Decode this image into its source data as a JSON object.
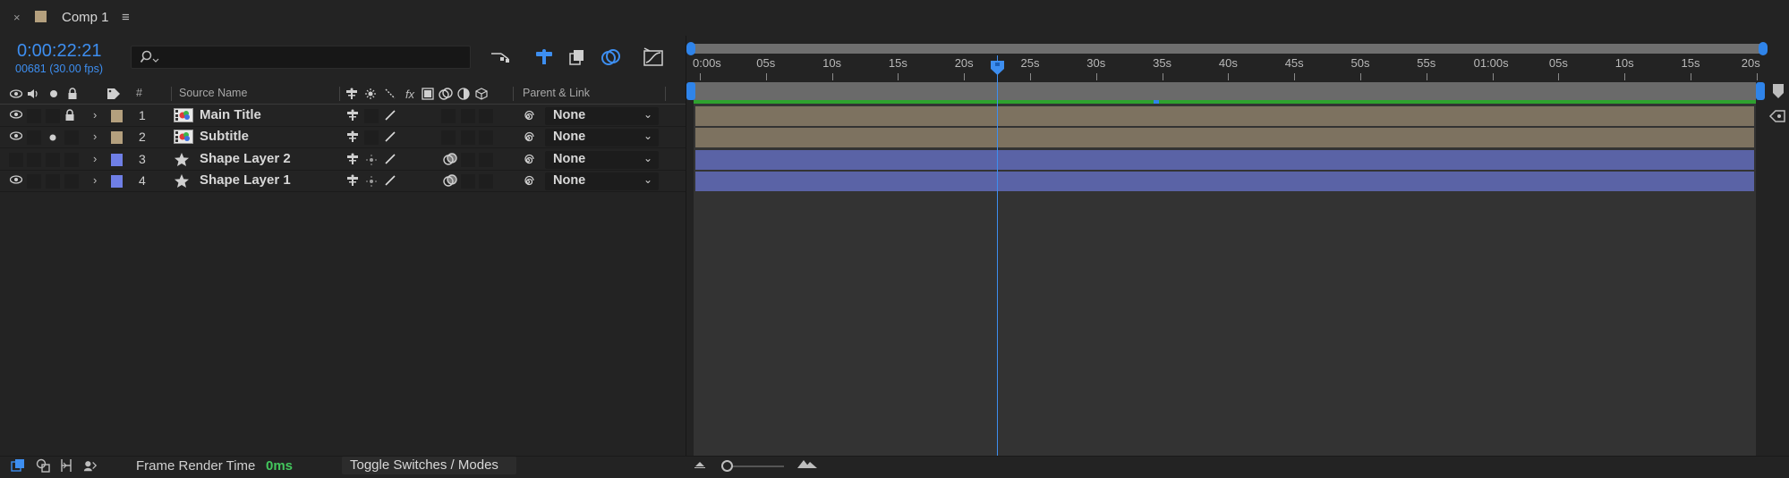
{
  "tab": {
    "close": "×",
    "title": "Comp 1",
    "menu": "≡",
    "swatch_color": "#b4a07e"
  },
  "header": {
    "timecode": "0:00:22:21",
    "frame_info": "00681 (30.00 fps)",
    "search_placeholder": "",
    "search_icon": "search-icon"
  },
  "columns": {
    "hash": "#",
    "source_name": "Source Name",
    "parent_link": "Parent & Link",
    "fx": "fx"
  },
  "layers": [
    {
      "index": "1",
      "name": "Main Title",
      "type": "footage",
      "label_color": "#b4a07e",
      "visible": true,
      "locked": true,
      "solo": false,
      "has_3d_switch": false,
      "parent": "None",
      "bar_color": "#7d7260"
    },
    {
      "index": "2",
      "name": "Subtitle",
      "type": "footage",
      "label_color": "#b4a07e",
      "visible": true,
      "locked": false,
      "solo": true,
      "has_3d_switch": false,
      "parent": "None",
      "bar_color": "#7d7260"
    },
    {
      "index": "3",
      "name": "Shape Layer 2",
      "type": "shape",
      "label_color": "#6f7fe6",
      "visible": false,
      "locked": false,
      "solo": false,
      "has_3d_switch": true,
      "parent": "None",
      "bar_color": "#5a63a6"
    },
    {
      "index": "4",
      "name": "Shape Layer 1",
      "type": "shape",
      "label_color": "#6f7fe6",
      "visible": true,
      "locked": false,
      "solo": false,
      "has_3d_switch": true,
      "parent": "None",
      "bar_color": "#5a63a6"
    }
  ],
  "ruler": {
    "labels": [
      "0:00s",
      "05s",
      "10s",
      "15s",
      "20s",
      "25s",
      "30s",
      "35s",
      "40s",
      "45s",
      "50s",
      "55s",
      "01:00s",
      "05s",
      "10s",
      "15s",
      "20s"
    ]
  },
  "playhead_seconds": 22.7,
  "footer": {
    "frame_render_label": "Frame Render Time",
    "frame_render_value": "0ms",
    "toggle_label": "Toggle Switches / Modes"
  },
  "colors": {
    "accent": "#3d8ef0",
    "workarea_bar": "#2ea12e"
  }
}
